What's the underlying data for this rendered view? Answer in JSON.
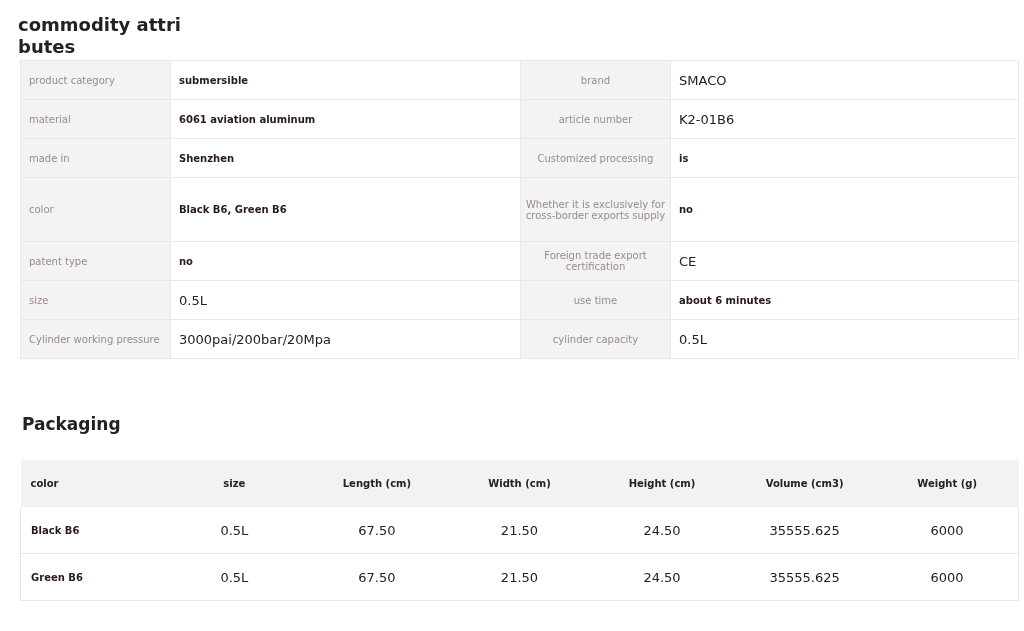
{
  "attributes": {
    "title": "commodity attributes",
    "rows": [
      {
        "cells": [
          {
            "label": "product category",
            "value": "submersible",
            "kind": "bold"
          },
          {
            "label": "brand",
            "value": "SMACO",
            "kind": "plain"
          }
        ]
      },
      {
        "cells": [
          {
            "label": "material",
            "value": "6061 aviation aluminum",
            "kind": "bold"
          },
          {
            "label": "article number",
            "value": "K2-01B6",
            "kind": "plain"
          }
        ]
      },
      {
        "cells": [
          {
            "label": "made in",
            "value": "Shenzhen",
            "kind": "bold"
          },
          {
            "label": "Customized processing",
            "value": "is",
            "kind": "bold"
          }
        ]
      },
      {
        "cells": [
          {
            "label": "color",
            "value": "Black B6, Green B6",
            "kind": "bold"
          },
          {
            "label": "Whether it is exclusively for cross-border exports supply",
            "value": "no",
            "kind": "bold"
          }
        ]
      },
      {
        "cells": [
          {
            "label": "patent type",
            "value": "no",
            "kind": "bold"
          },
          {
            "label": "Foreign trade export certification",
            "value": "CE",
            "kind": "plain"
          }
        ]
      },
      {
        "cells": [
          {
            "label": "size",
            "value": "0.5L",
            "kind": "plain"
          },
          {
            "label": "use time",
            "value": "about 6 minutes",
            "kind": "bold"
          }
        ]
      },
      {
        "cells": [
          {
            "label": "Cylinder working pressure",
            "value": "3000pai/200bar/20Mpa",
            "kind": "plain"
          },
          {
            "label": "cylinder capacity",
            "value": "0.5L",
            "kind": "plain"
          }
        ]
      }
    ]
  },
  "packaging": {
    "title": "Packaging",
    "columns": [
      "color",
      "size",
      "Length (cm)",
      "Width (cm)",
      "Height (cm)",
      "Volume (cm3)",
      "Weight (g)"
    ],
    "rows": [
      [
        "Black B6",
        "0.5L",
        "67.50",
        "21.50",
        "24.50",
        "35555.625",
        "6000"
      ],
      [
        "Green B6",
        "0.5L",
        "67.50",
        "21.50",
        "24.50",
        "35555.625",
        "6000"
      ]
    ]
  }
}
